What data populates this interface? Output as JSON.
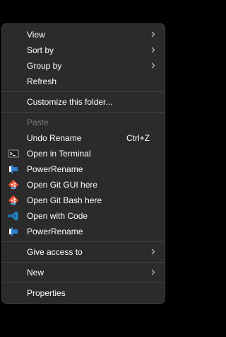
{
  "menu": {
    "items": {
      "view": {
        "label": "View"
      },
      "sort_by": {
        "label": "Sort by"
      },
      "group_by": {
        "label": "Group by"
      },
      "refresh": {
        "label": "Refresh"
      },
      "customize": {
        "label": "Customize this folder..."
      },
      "paste": {
        "label": "Paste"
      },
      "undo_rename": {
        "label": "Undo Rename",
        "shortcut": "Ctrl+Z"
      },
      "open_terminal": {
        "label": "Open in Terminal",
        "icon": "terminal-icon"
      },
      "powerrename_1": {
        "label": "PowerRename",
        "icon": "powerrename-icon"
      },
      "git_gui": {
        "label": "Open Git GUI here",
        "icon": "git-icon"
      },
      "git_bash": {
        "label": "Open Git Bash here",
        "icon": "git-icon"
      },
      "open_code": {
        "label": "Open with Code",
        "icon": "vscode-icon"
      },
      "powerrename_2": {
        "label": "PowerRename",
        "icon": "powerrename-icon"
      },
      "give_access": {
        "label": "Give access to"
      },
      "new": {
        "label": "New"
      },
      "properties": {
        "label": "Properties"
      }
    }
  },
  "colors": {
    "background": "#000000",
    "menu_bg": "#2b2b2b",
    "separator": "#414141",
    "text": "#ffffff",
    "disabled_text": "#7a7a7a",
    "vscode_blue": "#2489ca",
    "git_orange": "#f05133"
  }
}
